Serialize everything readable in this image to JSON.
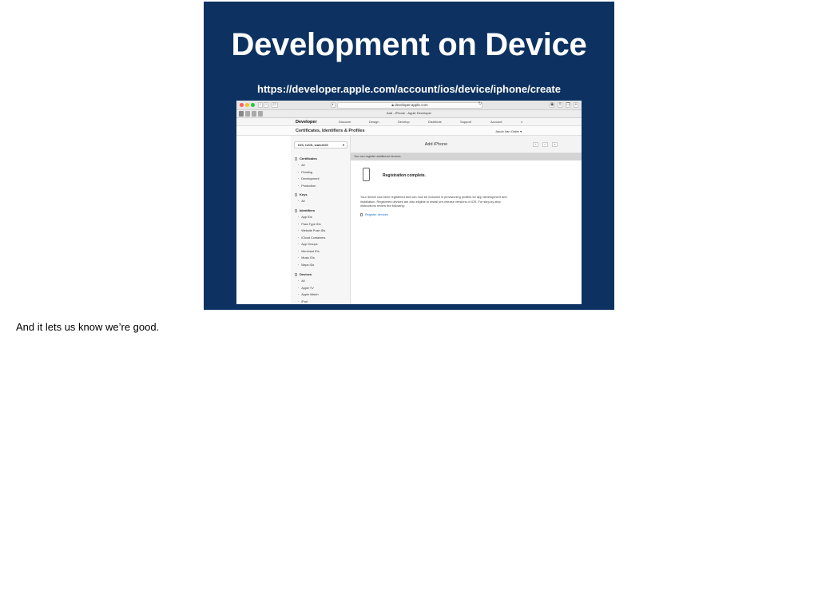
{
  "slide": {
    "title": "Development on Device",
    "url": "https://developer.apple.com/account/ios/device/iphone/create"
  },
  "browser": {
    "address": "developer.apple.com",
    "tab_title": "Add - iPhone - Apple Developer",
    "nav": {
      "logo": "Developer",
      "items": [
        "Discover",
        "Design",
        "Develop",
        "Distribute",
        "Support",
        "Account"
      ]
    },
    "subheader": {
      "title": "Certificates, Identifiers & Profiles",
      "user": "Jacob Van Order"
    },
    "sidebar": {
      "platform": "iOS, tvOS, watchOS",
      "sections": [
        {
          "title": "Certificates",
          "items": [
            "All",
            "Pending",
            "Development",
            "Production"
          ]
        },
        {
          "title": "Keys",
          "items": [
            "All"
          ]
        },
        {
          "title": "Identifiers",
          "items": [
            "App IDs",
            "Pass Type IDs",
            "Website Push IDs",
            "iCloud Containers",
            "App Groups",
            "Merchant IDs",
            "Music IDs",
            "Maps IDs"
          ]
        },
        {
          "title": "Devices",
          "items": [
            "All",
            "Apple TV",
            "Apple Watch",
            "iPad"
          ]
        }
      ]
    },
    "main": {
      "title": "Add iPhone",
      "buttons": [
        "+",
        "✓",
        "⌕"
      ],
      "notice": "You can register additional devices.",
      "registration_title": "Registration complete.",
      "description": "Your device has been registered and can now be included in provisioning profiles for app development and installation. Registered devices are also eligible to install pre-release versions of iOS. For step-by-step instructions review the following:",
      "link": "Register devices"
    }
  },
  "caption": "And it lets us know we’re good.",
  "colors": {
    "slide_bg": "#0d3261",
    "link": "#1a73c9",
    "traffic_red": "#ff5f57",
    "traffic_yellow": "#febc2e",
    "traffic_green": "#28c840"
  }
}
